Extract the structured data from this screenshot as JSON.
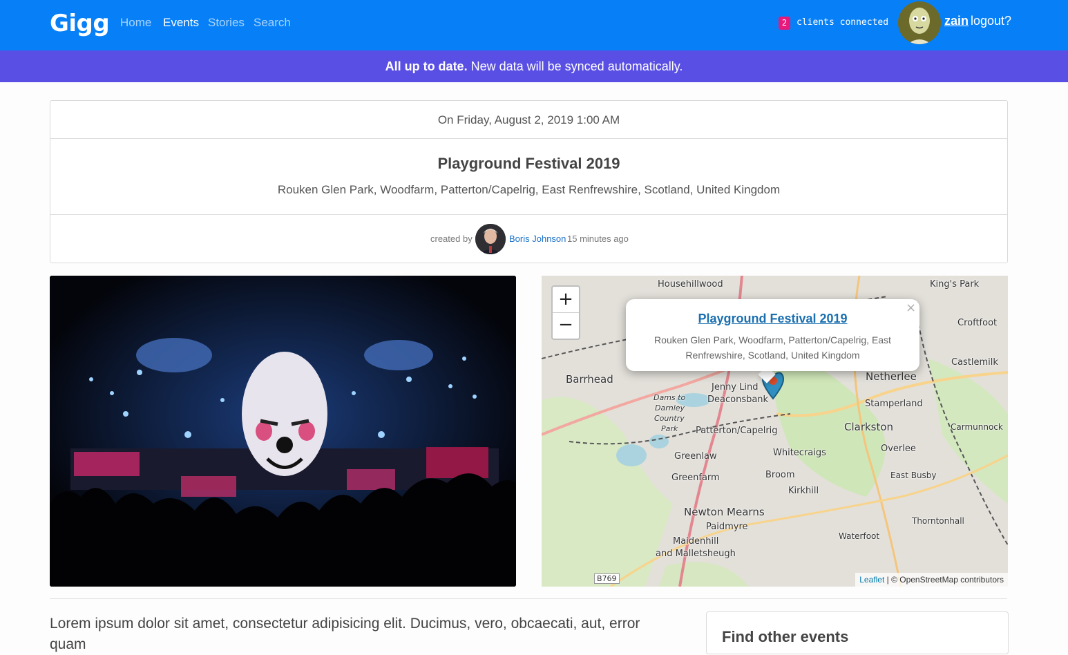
{
  "nav": {
    "brand": "Gigg",
    "links": [
      "Home",
      "Events",
      "Stories",
      "Search"
    ],
    "active": "Events",
    "clients_count": "2",
    "clients_label": "clients connected",
    "username": "zain",
    "logout_label": "logout?"
  },
  "sync": {
    "bold": "All up to date.",
    "message": "New data will be synced automatically."
  },
  "event": {
    "date": "On Friday, August 2, 2019 1:00 AM",
    "title": "Playground Festival 2019",
    "address": "Rouken Glen Park, Woodfarm, Patterton/Capelrig, East Renfrewshire, Scotland, United Kingdom",
    "created_by_label": "created by",
    "creator": "Boris Johnson",
    "created_ago": "15 minutes ago"
  },
  "map": {
    "zoom_in": "+",
    "zoom_out": "−",
    "popup_close": "×",
    "popup_title": "Playground Festival 2019",
    "popup_address": "Rouken Glen Park, Woodfarm, Patterton/Capelrig, East Renfrewshire, Scotland, United Kingdom",
    "attribution_link": "Leaflet",
    "attribution_text": " | © OpenStreetMap contributors",
    "places": {
      "househillwood": "Househillwood",
      "kings_park": "King's Park",
      "croftfoot": "Croftfoot",
      "castlemilk": "Castlemilk",
      "barrhead": "Barrhead",
      "netherlee": "Netherlee",
      "jenny_lind": "Jenny Lind",
      "deaconsbank": "Deaconsbank",
      "stamperland": "Stamperland",
      "dams": "Dams to",
      "darnley": "Darnley",
      "country": "Country",
      "park": "Park",
      "patterton": "Patterton/Capelrig",
      "clarkston": "Clarkston",
      "carmunnock": "Carmunnock",
      "greenlaw": "Greenlaw",
      "whitecraigs": "Whitecraigs",
      "overlee": "Overlee",
      "greenfarm": "Greenfarm",
      "broom": "Broom",
      "east_busby": "East Busby",
      "kirkhill": "Kirkhill",
      "newton_mearns": "Newton Mearns",
      "paidmyre": "Paidmyre",
      "thorntonhall": "Thorntonhall",
      "maidenhill": "Maidenhill",
      "malletsheugh": "and Malletsheugh",
      "waterfoot": "Waterfoot",
      "b769": "B769"
    }
  },
  "body": {
    "lorem": "Lorem ipsum dolor sit amet, consectetur adipisicing elit. Ducimus, vero, obcaecati, aut, error quam",
    "find_title": "Find other events"
  },
  "colors": {
    "nav": "#0780f7",
    "sync_bar": "#5a4fe4",
    "badge": "#e8197b",
    "link": "#1a6fc9"
  }
}
